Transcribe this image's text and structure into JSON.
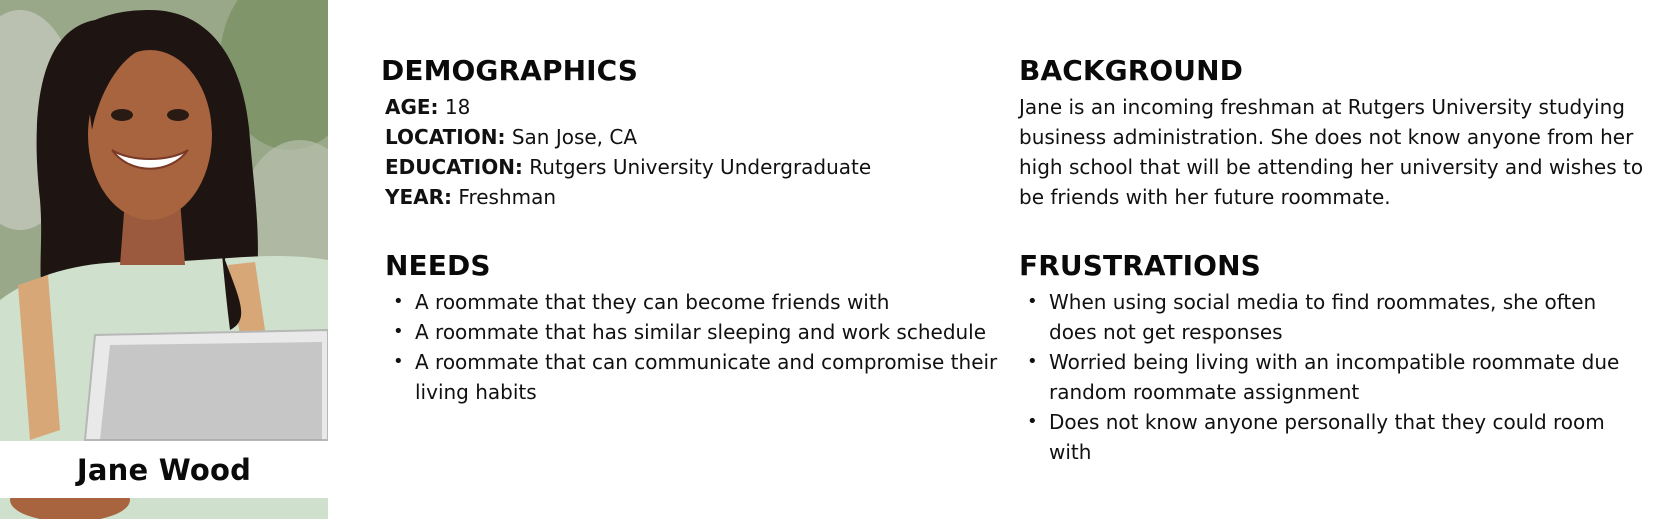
{
  "persona": {
    "name": "Jane Wood"
  },
  "demographics": {
    "heading": "DEMOGRAPHICS",
    "fields": [
      {
        "label": "AGE:",
        "value": "18"
      },
      {
        "label": "LOCATION:",
        "value": "San Jose, CA"
      },
      {
        "label": "EDUCATION:",
        "value": "Rutgers University Undergraduate"
      },
      {
        "label": "YEAR:",
        "value": "Freshman"
      }
    ]
  },
  "needs": {
    "heading": "NEEDS",
    "items": [
      "A roommate that they can become friends with",
      "A roommate that has similar sleeping and work schedule",
      "A roommate that can communicate and compromise their living habits"
    ]
  },
  "background": {
    "heading": "BACKGROUND",
    "text": "Jane is an incoming freshman at Rutgers University studying business administration. She does not know anyone from her high school that will be attending her university and wishes to be friends with her future roommate."
  },
  "frustrations": {
    "heading": "FRUSTRATIONS",
    "items": [
      "When using social media to find roommates, she often does not get responses",
      "Worried being living with an incompatible roommate due random roommate assignment",
      "Does not know anyone personally that they could room with"
    ]
  },
  "bullet_glyph": "•"
}
